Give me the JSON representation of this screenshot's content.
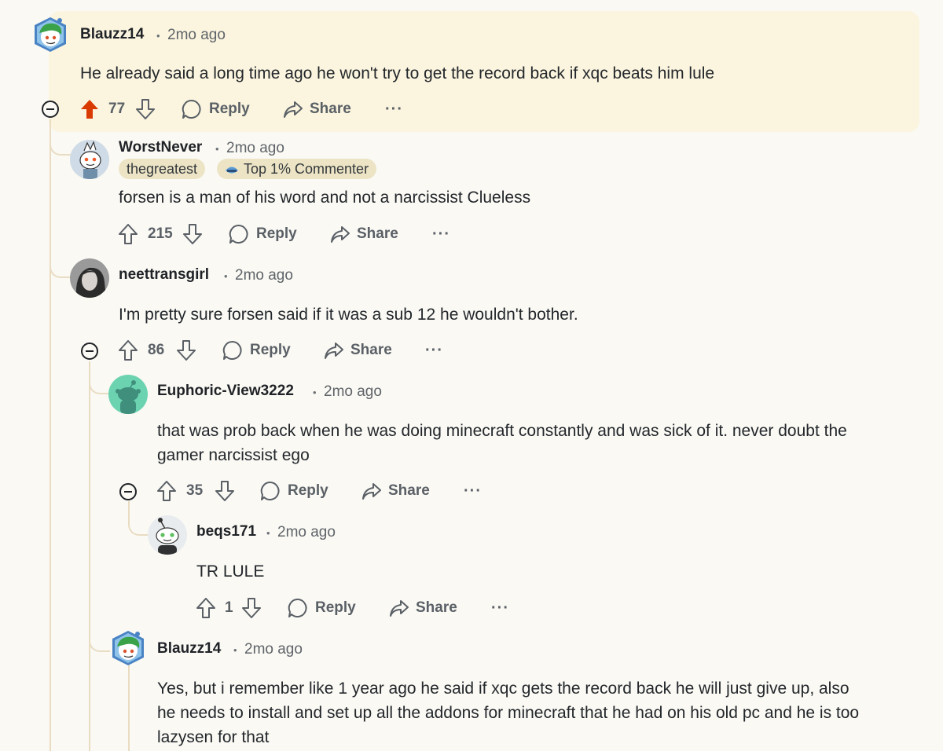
{
  "comments": [
    {
      "username": "Blauzz14",
      "time": "2mo ago",
      "body": "He already said a long time ago he won't try to get the record back if xqc beats him lule",
      "score": "77",
      "upvoted": true,
      "reply_label": "Reply",
      "share_label": "Share",
      "more_label": "···",
      "avatar_icon": "snoo-green-hair-avatar"
    },
    {
      "username": "WorstNever",
      "time": "2mo ago",
      "flairs": [
        "thegreatest",
        "Top 1% Commenter"
      ],
      "body": "forsen is a man of his word and not a narcissist Clueless",
      "score": "215",
      "reply_label": "Reply",
      "share_label": "Share",
      "more_label": "···",
      "avatar_icon": "snoo-mohawk-avatar"
    },
    {
      "username": "neettransgirl",
      "time": "2mo ago",
      "body": "I'm pretty sure forsen said if it was a sub 12 he wouldn't bother.",
      "score": "86",
      "reply_label": "Reply",
      "share_label": "Share",
      "more_label": "···",
      "avatar_icon": "photo-avatar"
    },
    {
      "username": "Euphoric-View3222",
      "time": "2mo ago",
      "body_lines": [
        "that was prob back when he was doing minecraft constantly and was sick of it. never doubt the",
        "gamer narcissist ego"
      ],
      "score": "35",
      "reply_label": "Reply",
      "share_label": "Share",
      "more_label": "···",
      "avatar_icon": "default-snoo-teal-avatar"
    },
    {
      "username": "beqs171",
      "time": "2mo ago",
      "body": "TR LULE",
      "score": "1",
      "reply_label": "Reply",
      "share_label": "Share",
      "more_label": "···",
      "avatar_icon": "snoo-white-avatar"
    },
    {
      "username": "Blauzz14",
      "time": "2mo ago",
      "body_lines": [
        "Yes, but i remember like 1 year ago he said if xqc gets the record back he will just give up, also",
        "he needs to install and set up all the addons for minecraft that he had on his old pc and he is too",
        "lazysen for that"
      ],
      "avatar_icon": "snoo-green-hair-avatar"
    }
  ],
  "colors": {
    "background": "#faf9f4",
    "highlight": "#fbf5df",
    "upvote_active": "#d93a00",
    "thread_line": "#e9dcc2",
    "flair_bg": "#ece4c5"
  }
}
